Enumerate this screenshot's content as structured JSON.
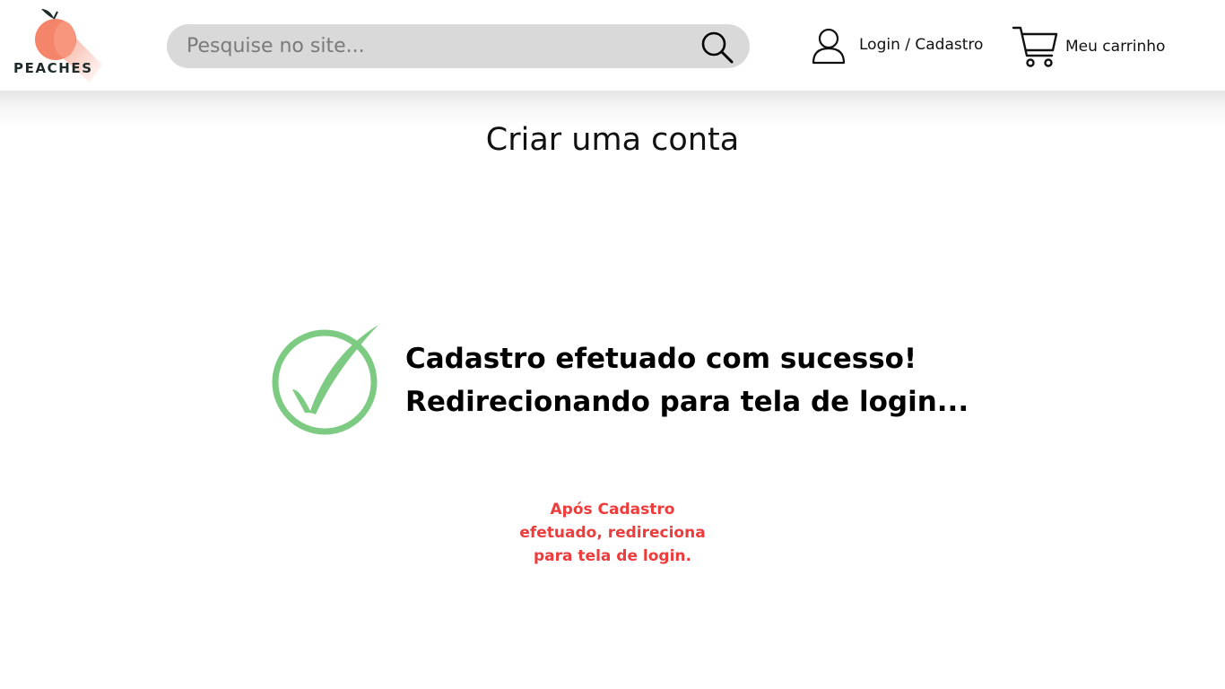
{
  "header": {
    "logo_text": "PEACHES",
    "search": {
      "placeholder": "Pesquise no site...",
      "value": ""
    },
    "login_label": "Login / Cadastro",
    "cart_label": "Meu carrinho",
    "icons": {
      "search": "search-icon",
      "user": "user-icon",
      "cart": "cart-icon"
    }
  },
  "main": {
    "title": "Criar uma conta",
    "success": {
      "line1": "Cadastro efetuado com sucesso!",
      "line2": "Redirecionando para tela de login...",
      "icon": "check-circle-icon"
    },
    "note": {
      "line1": "Após Cadastro",
      "line2": "efetuado, redireciona",
      "line3": "para tela de login."
    }
  },
  "colors": {
    "brand_peach": "#f4856b",
    "search_bg": "#d9d9d9",
    "success_green": "#7dcb82",
    "note_red": "#ee3b3b"
  }
}
